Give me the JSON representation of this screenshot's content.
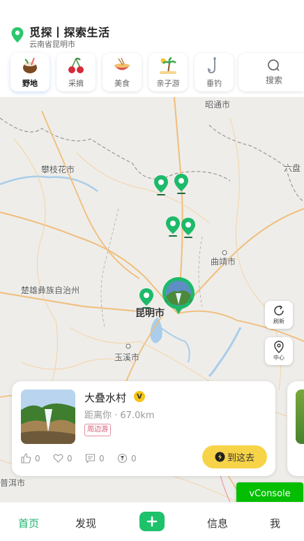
{
  "header": {
    "title": "觅探丨探索生活",
    "location": "云南省昆明市"
  },
  "categories": [
    {
      "label": "野地",
      "icon": "coconut-icon",
      "active": true
    },
    {
      "label": "采摘",
      "icon": "cherry-icon",
      "active": false
    },
    {
      "label": "美食",
      "icon": "food-bowl-icon",
      "active": false
    },
    {
      "label": "亲子游",
      "icon": "beach-icon",
      "active": false
    },
    {
      "label": "垂钓",
      "icon": "fishhook-icon",
      "active": false
    }
  ],
  "search": {
    "label": "搜索"
  },
  "map": {
    "cities": [
      "昭通市",
      "攀枝花市",
      "六盘",
      "曲靖市",
      "楚雄彝族自治州",
      "昆明市",
      "玉溪市",
      "普洱市"
    ],
    "controls": {
      "refresh": "刷新",
      "center": "中心"
    }
  },
  "card": {
    "name": "大叠水村",
    "badge": "V",
    "distance": "距离你 · 67.0km",
    "tag": "周边游",
    "likes": "0",
    "favorites": "0",
    "comments": "0",
    "coins": "0",
    "go_label": "到这去"
  },
  "vconsole": "vConsole",
  "tabbar": {
    "home": "首页",
    "discover": "发现",
    "messages": "信息",
    "me": "我"
  },
  "colors": {
    "accent": "#1db36b",
    "marker": "#1dba6a",
    "go_button": "#f7d348",
    "vconsole": "#04be02"
  }
}
